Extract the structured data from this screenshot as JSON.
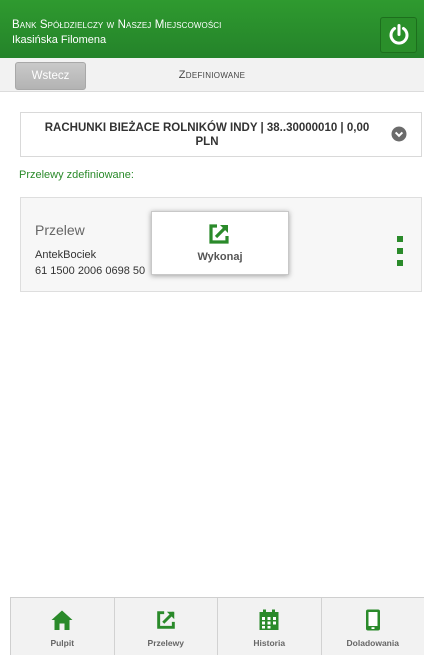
{
  "header": {
    "bank_name": "Bank Spółdzielczy w Naszej Miejscowości",
    "user_name": "Ikasińska Filomena",
    "power_icon": "power-icon"
  },
  "topbar": {
    "back_label": "Wstecz",
    "title": "Zdefiniowane"
  },
  "account": {
    "label": "RACHUNKI BIEŻACE ROLNIKÓW INDY | 38..30000010 | 0,00 PLN",
    "chevron_icon": "chevron-down-icon"
  },
  "section_label": "Przelewy zdefiniowane:",
  "transfer": {
    "type": "Przelew",
    "recipient": "AntekBociek",
    "account": "61 1500 2006 0698 50",
    "more_icon": "more-vertical-icon"
  },
  "popup": {
    "action_label": "Wykonaj",
    "icon": "external-link-icon"
  },
  "bottom_nav": [
    {
      "label": "Pulpit",
      "icon": "home-icon"
    },
    {
      "label": "Przelewy",
      "icon": "external-link-icon"
    },
    {
      "label": "Historia",
      "icon": "calendar-icon"
    },
    {
      "label": "Doladowania",
      "icon": "phone-icon"
    }
  ],
  "colors": {
    "accent": "#2a8a2a",
    "header_bg": "#2a8a2a",
    "text": "#333333"
  }
}
